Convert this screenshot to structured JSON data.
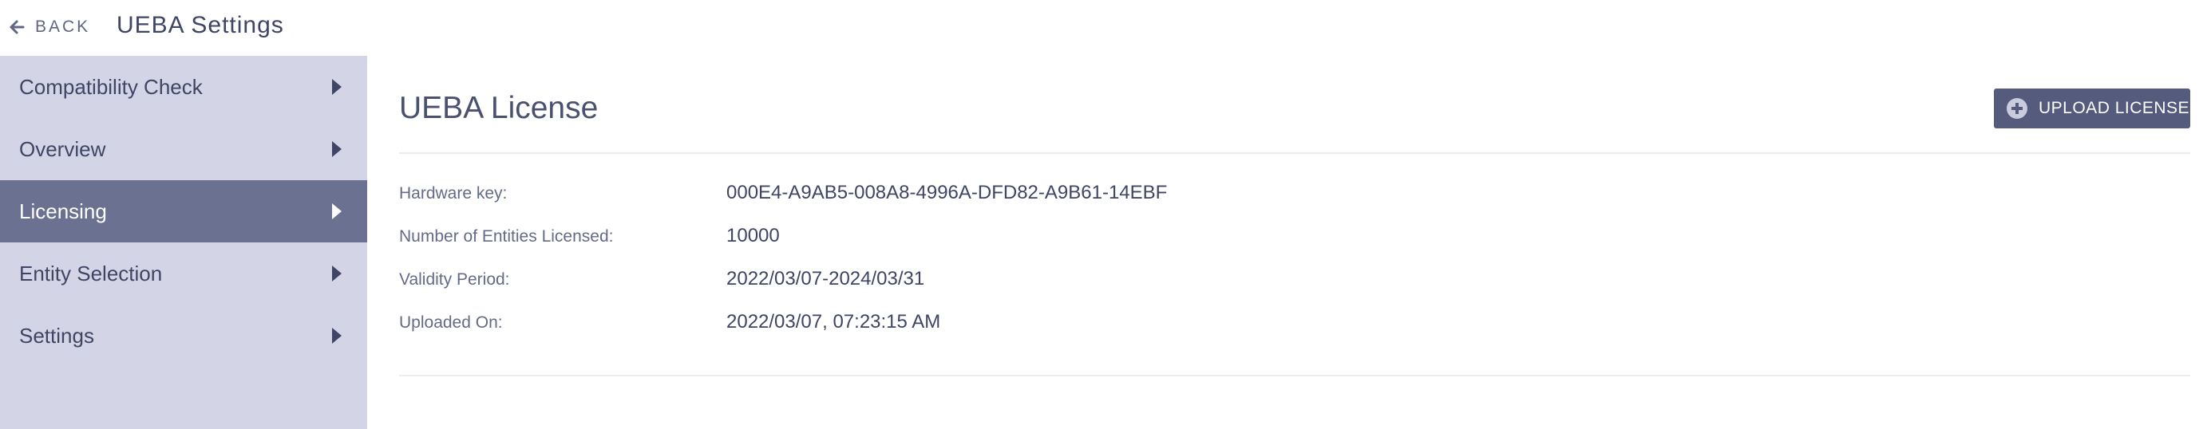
{
  "header": {
    "back_label": "BACK",
    "title": "UEBA Settings"
  },
  "sidebar": {
    "items": [
      {
        "label": "Compatibility Check",
        "active": false
      },
      {
        "label": "Overview",
        "active": false
      },
      {
        "label": "Licensing",
        "active": true
      },
      {
        "label": "Entity Selection",
        "active": false
      },
      {
        "label": "Settings",
        "active": false
      }
    ]
  },
  "license": {
    "title": "UEBA License",
    "upload_button_label": "UPLOAD LICENSE",
    "fields": [
      {
        "label": "Hardware key:",
        "value": "000E4-A9AB5-008A8-4996A-DFD82-A9B61-14EBF"
      },
      {
        "label": "Number of Entities Licensed:",
        "value": "10000"
      },
      {
        "label": "Validity Period:",
        "value": "2022/03/07-2024/03/31"
      },
      {
        "label": "Uploaded On:",
        "value": "2022/03/07, 07:23:15 AM"
      }
    ]
  },
  "icons": {
    "back": "arrow-left-icon",
    "caret": "caret-right-icon",
    "upload": "plus-circle-icon"
  },
  "colors": {
    "sidebar_bg": "#d3d4e5",
    "sidebar_active_bg": "#6b7190",
    "button_bg": "#545b7c",
    "text_primary": "#3e4565"
  }
}
